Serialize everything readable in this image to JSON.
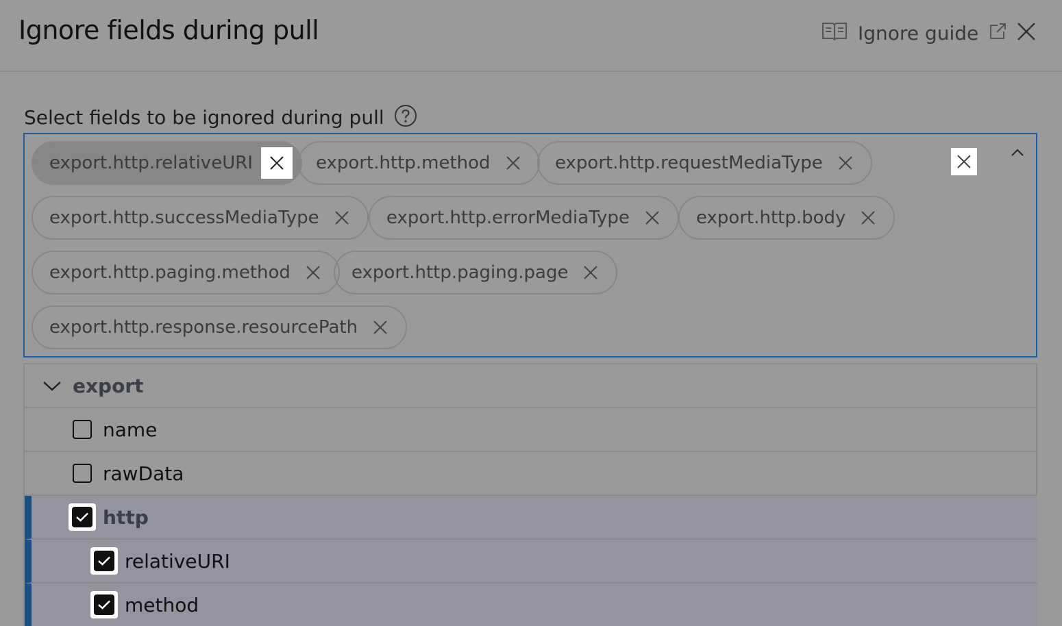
{
  "dialog": {
    "title": "Ignore fields during pull",
    "guide_label": "Ignore guide",
    "icons": {
      "guide": "book-icon",
      "external": "external-link-icon",
      "close": "close-icon"
    }
  },
  "field": {
    "label": "Select fields to be ignored during pull",
    "help_icon": "help-circle-icon"
  },
  "chips": [
    {
      "label": "export.http.relativeURI"
    },
    {
      "label": "export.http.method"
    },
    {
      "label": "export.http.requestMediaType"
    },
    {
      "label": "export.http.successMediaType"
    },
    {
      "label": "export.http.errorMediaType"
    },
    {
      "label": "export.http.body"
    },
    {
      "label": "export.http.paging.method"
    },
    {
      "label": "export.http.paging.page"
    },
    {
      "label": "export.http.response.resourcePath"
    }
  ],
  "tree": {
    "root": {
      "label": "export",
      "expanded": true
    },
    "items": [
      {
        "label": "name",
        "checked": false
      },
      {
        "label": "rawData",
        "checked": false
      },
      {
        "label": "http",
        "checked": true
      },
      {
        "label": "relativeURI",
        "checked": true
      },
      {
        "label": "method",
        "checked": true
      }
    ]
  },
  "colors": {
    "accent": "#1f5fa0",
    "selected_bar": "#1c4f86",
    "overlay": "#9a9a9a"
  }
}
